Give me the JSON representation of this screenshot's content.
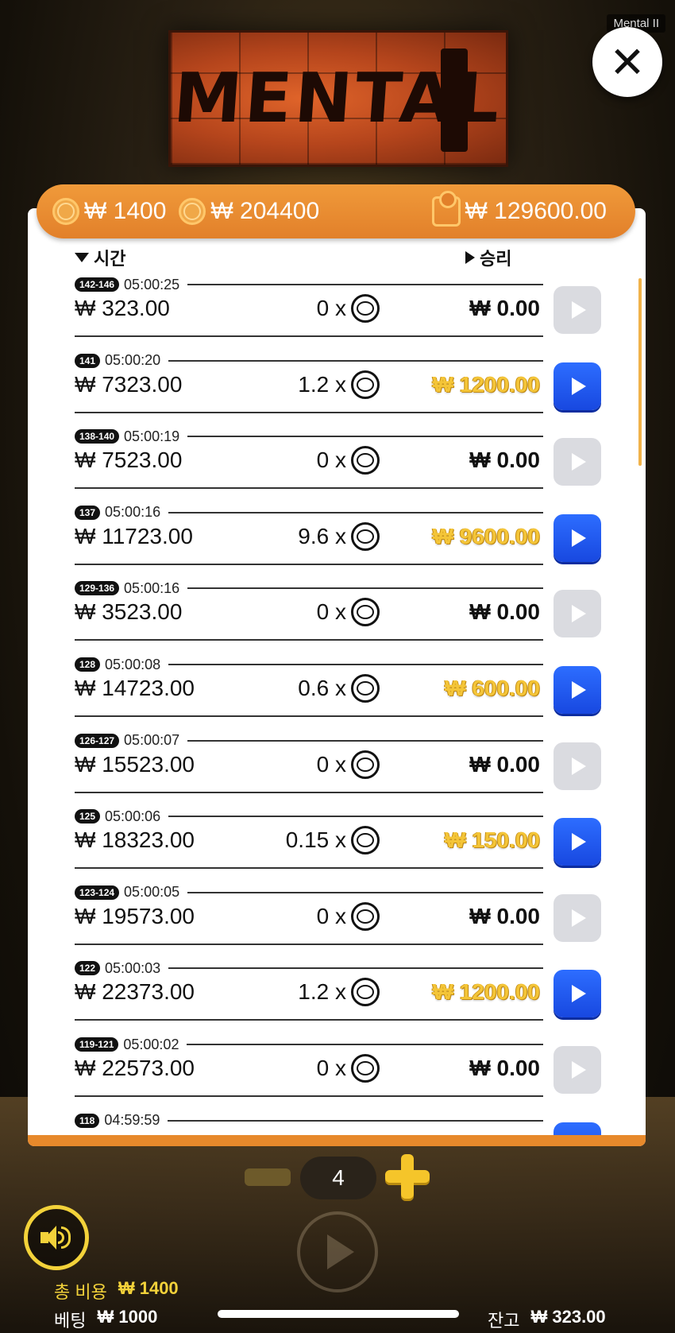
{
  "window": {
    "tag": "Mental II"
  },
  "logo": {
    "text": "MENTAL"
  },
  "header": {
    "bet_amount": "₩ 1400",
    "coin_amount": "₩ 204400",
    "wallet_amount": "₩ 129600.00"
  },
  "columns": {
    "time": "시간",
    "win": "승리"
  },
  "rounds": [
    {
      "range": "142-146",
      "time": "05:00:25",
      "balance": "₩ 323.00",
      "mult": "0 x",
      "win": "₩ 0.00",
      "won": false
    },
    {
      "range": "141",
      "time": "05:00:20",
      "balance": "₩ 7323.00",
      "mult": "1.2 x",
      "win": "₩ 1200.00",
      "won": true
    },
    {
      "range": "138-140",
      "time": "05:00:19",
      "balance": "₩ 7523.00",
      "mult": "0 x",
      "win": "₩ 0.00",
      "won": false
    },
    {
      "range": "137",
      "time": "05:00:16",
      "balance": "₩ 11723.00",
      "mult": "9.6 x",
      "win": "₩ 9600.00",
      "won": true
    },
    {
      "range": "129-136",
      "time": "05:00:16",
      "balance": "₩ 3523.00",
      "mult": "0 x",
      "win": "₩ 0.00",
      "won": false
    },
    {
      "range": "128",
      "time": "05:00:08",
      "balance": "₩ 14723.00",
      "mult": "0.6 x",
      "win": "₩ 600.00",
      "won": true
    },
    {
      "range": "126-127",
      "time": "05:00:07",
      "balance": "₩ 15523.00",
      "mult": "0 x",
      "win": "₩ 0.00",
      "won": false
    },
    {
      "range": "125",
      "time": "05:00:06",
      "balance": "₩ 18323.00",
      "mult": "0.15 x",
      "win": "₩ 150.00",
      "won": true
    },
    {
      "range": "123-124",
      "time": "05:00:05",
      "balance": "₩ 19573.00",
      "mult": "0 x",
      "win": "₩ 0.00",
      "won": false
    },
    {
      "range": "122",
      "time": "05:00:03",
      "balance": "₩ 22373.00",
      "mult": "1.2 x",
      "win": "₩ 1200.00",
      "won": true
    },
    {
      "range": "119-121",
      "time": "05:00:02",
      "balance": "₩ 22573.00",
      "mult": "0 x",
      "win": "₩ 0.00",
      "won": false
    },
    {
      "range": "118",
      "time": "04:59:59",
      "balance": "",
      "mult": "",
      "win": "",
      "won": true
    }
  ],
  "stepper": {
    "value": "4"
  },
  "footer": {
    "total_cost_label": "총 비용",
    "total_cost_value": "₩ 1400",
    "bet_label": "베팅",
    "bet_value": "₩ 1000",
    "balance_label": "잔고",
    "balance_value": "₩ 323.00"
  },
  "colors": {
    "accent_orange": "#e7892b",
    "play_blue": "#1e55f0",
    "win_gold": "#f4c538",
    "sound_yellow": "#f3d23a"
  },
  "icons": {
    "close": "close-icon",
    "coin": "coin-icon",
    "wallet": "wallet-icon",
    "play": "play-icon",
    "sound": "speaker-icon"
  }
}
